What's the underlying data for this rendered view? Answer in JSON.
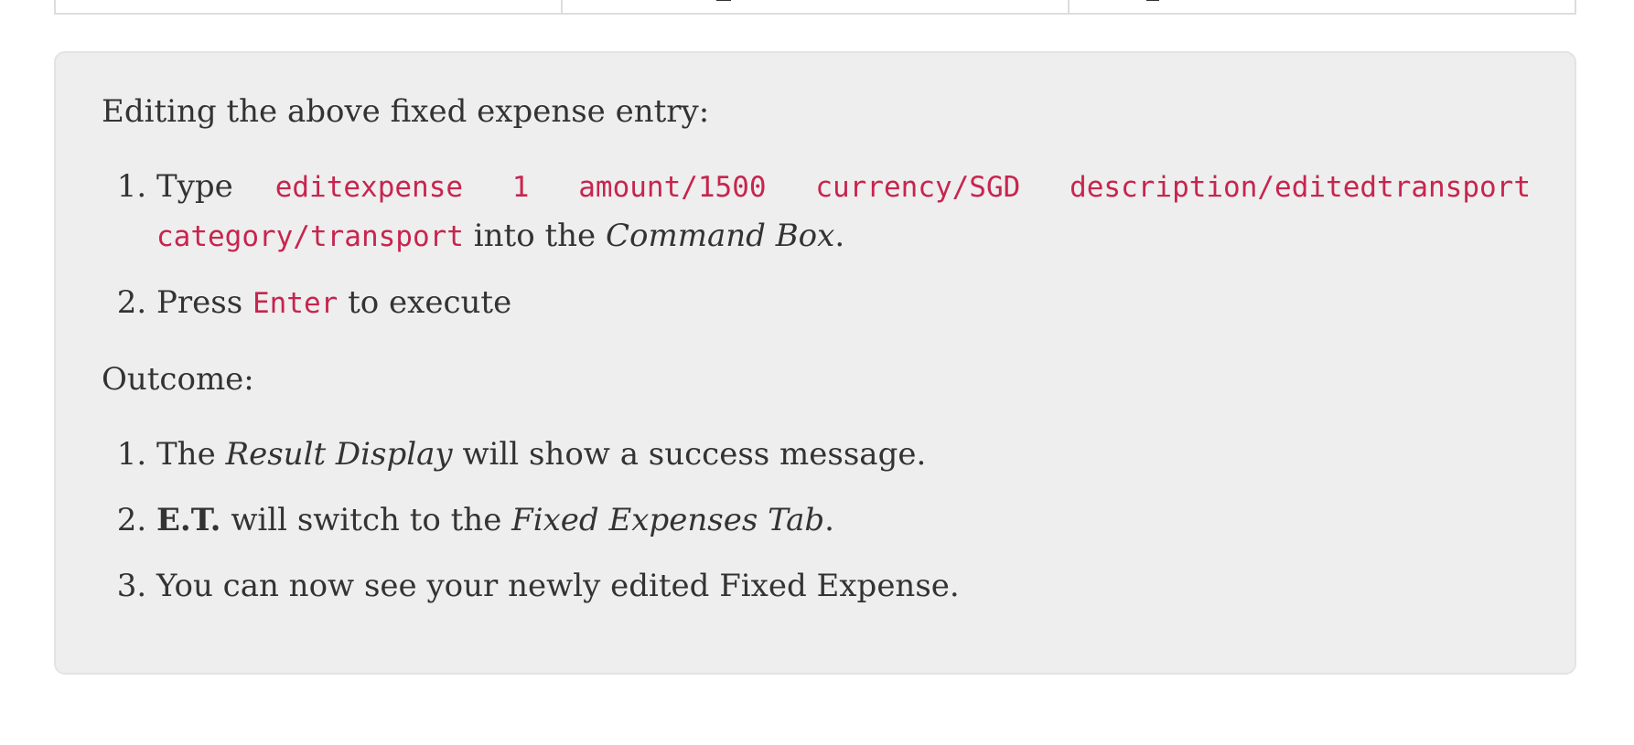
{
  "intro": "Editing the above fixed expense entry:",
  "steps": {
    "step1": {
      "prefix": "Type",
      "command": "editexpense 1 amount/1500 currency/SGD description/editedtransport category/transport",
      "middle": "into the",
      "target": "Command Box",
      "suffix": "."
    },
    "step2": {
      "prefix": "Press",
      "key": "Enter",
      "suffix": "to execute"
    }
  },
  "outcome_label": "Outcome:",
  "outcomes": {
    "o1": {
      "prefix": "The",
      "target": "Result Display",
      "suffix": "will show a success message."
    },
    "o2": {
      "app": "E.T.",
      "middle": "will switch to the",
      "target": "Fixed Expenses Tab",
      "suffix": "."
    },
    "o3": {
      "text": "You can now see your newly edited Fixed Expense."
    }
  },
  "colors": {
    "card_background": "#eeeeee",
    "code_text": "#c7254e",
    "body_text": "#333333"
  }
}
